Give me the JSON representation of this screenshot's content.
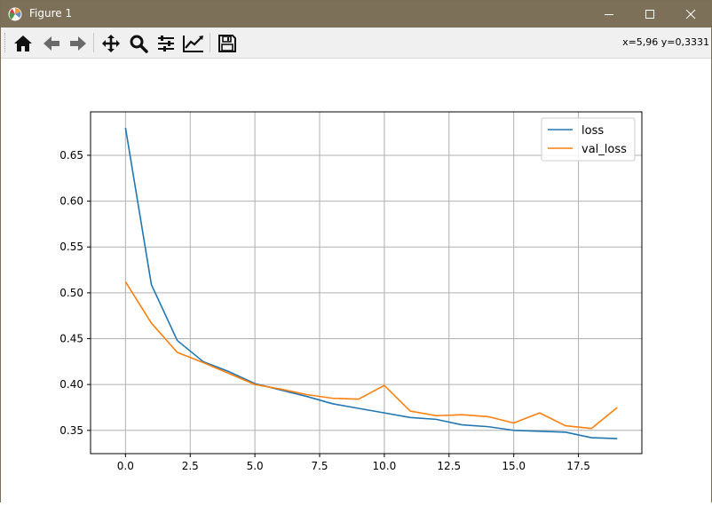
{
  "window": {
    "title": "Figure 1"
  },
  "toolbar": {
    "buttons": [
      {
        "icon": "home-icon"
      },
      {
        "icon": "back-icon"
      },
      {
        "icon": "forward-icon"
      },
      {
        "icon": "pan-icon"
      },
      {
        "icon": "zoom-icon"
      },
      {
        "icon": "subplots-icon"
      },
      {
        "icon": "edit-axis-icon"
      },
      {
        "icon": "save-icon"
      }
    ],
    "coords": "x=5,96 y=0,3331"
  },
  "colors": {
    "loss": "#1f77b4",
    "val_loss": "#ff7f0e",
    "grid": "#b0b0b0",
    "titlebar": "#7c7058"
  },
  "chart_data": {
    "type": "line",
    "x": [
      0,
      1,
      2,
      3,
      4,
      5,
      6,
      7,
      8,
      9,
      10,
      11,
      12,
      13,
      14,
      15,
      16,
      17,
      18,
      19
    ],
    "series": [
      {
        "name": "loss",
        "values": [
          0.68,
          0.509,
          0.448,
          0.425,
          0.414,
          0.401,
          0.394,
          0.387,
          0.379,
          0.374,
          0.369,
          0.364,
          0.362,
          0.356,
          0.354,
          0.35,
          0.349,
          0.348,
          0.342,
          0.341
        ]
      },
      {
        "name": "val_loss",
        "values": [
          0.512,
          0.467,
          0.435,
          0.424,
          0.412,
          0.4,
          0.395,
          0.389,
          0.385,
          0.384,
          0.399,
          0.371,
          0.366,
          0.367,
          0.365,
          0.358,
          0.369,
          0.355,
          0.352,
          0.375
        ]
      }
    ],
    "xticks": [
      "0.0",
      "2.5",
      "5.0",
      "7.5",
      "10.0",
      "12.5",
      "15.0",
      "17.5"
    ],
    "xtick_values": [
      0,
      2.5,
      5,
      7.5,
      10,
      12.5,
      15,
      17.5
    ],
    "yticks": [
      "0.35",
      "0.40",
      "0.45",
      "0.50",
      "0.55",
      "0.60",
      "0.65"
    ],
    "ytick_values": [
      0.35,
      0.4,
      0.45,
      0.5,
      0.55,
      0.6,
      0.65
    ],
    "xlim": [
      -1.35,
      19.95
    ],
    "ylim": [
      0.3246,
      0.6974
    ],
    "grid": true,
    "legend_position": "top-right",
    "title": "",
    "xlabel": "",
    "ylabel": ""
  }
}
